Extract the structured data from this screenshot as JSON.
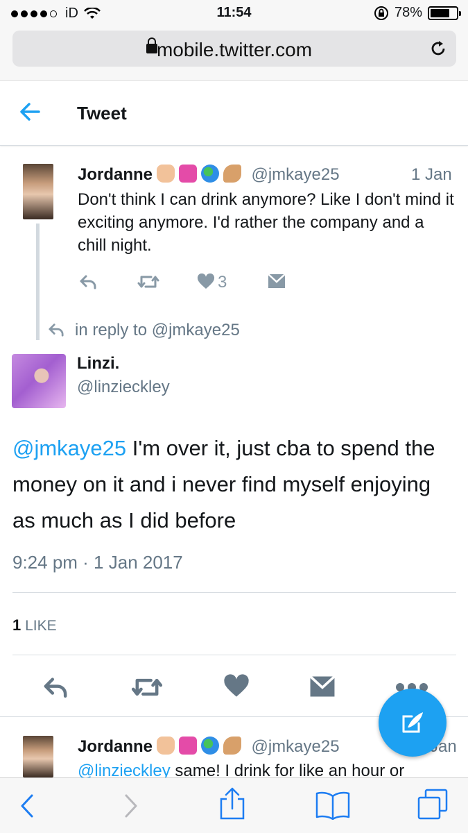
{
  "status_bar": {
    "carrier": "iD",
    "time": "11:54",
    "battery_text": "78%",
    "battery_level": 0.78
  },
  "browser": {
    "url": "mobile.twitter.com",
    "reload_icon": "reload-icon"
  },
  "header": {
    "title": "Tweet",
    "back_icon": "back-arrow-icon"
  },
  "parent_tweet": {
    "name": "Jordanne",
    "handle": "@jmkaye25",
    "date": "1 Jan",
    "text": "Don't think I can drink anymore? Like I don't mind it exciting anymore. I'd rather the company and a chill night.",
    "like_count": "3"
  },
  "reply_context": {
    "text": "in reply to @jmkaye25"
  },
  "main_tweet": {
    "name": "Linzi.",
    "handle": "@linzieckley",
    "mention": "@jmkaye25",
    "text": " I'm over it, just cba to spend the money on it and i never find myself enjoying as much as I did before",
    "timestamp": "9:24 pm · 1 Jan 2017",
    "like_count": "1",
    "like_label": "LIKE"
  },
  "next_tweet": {
    "name": "Jordanne",
    "handle": "@jmkaye25",
    "date": "Jan",
    "mention": "@linzieckley",
    "text": " same! I drink for like an hour or"
  },
  "colors": {
    "accent": "#1da1f2",
    "muted": "#657786",
    "icon_gray": "#8899a6"
  }
}
